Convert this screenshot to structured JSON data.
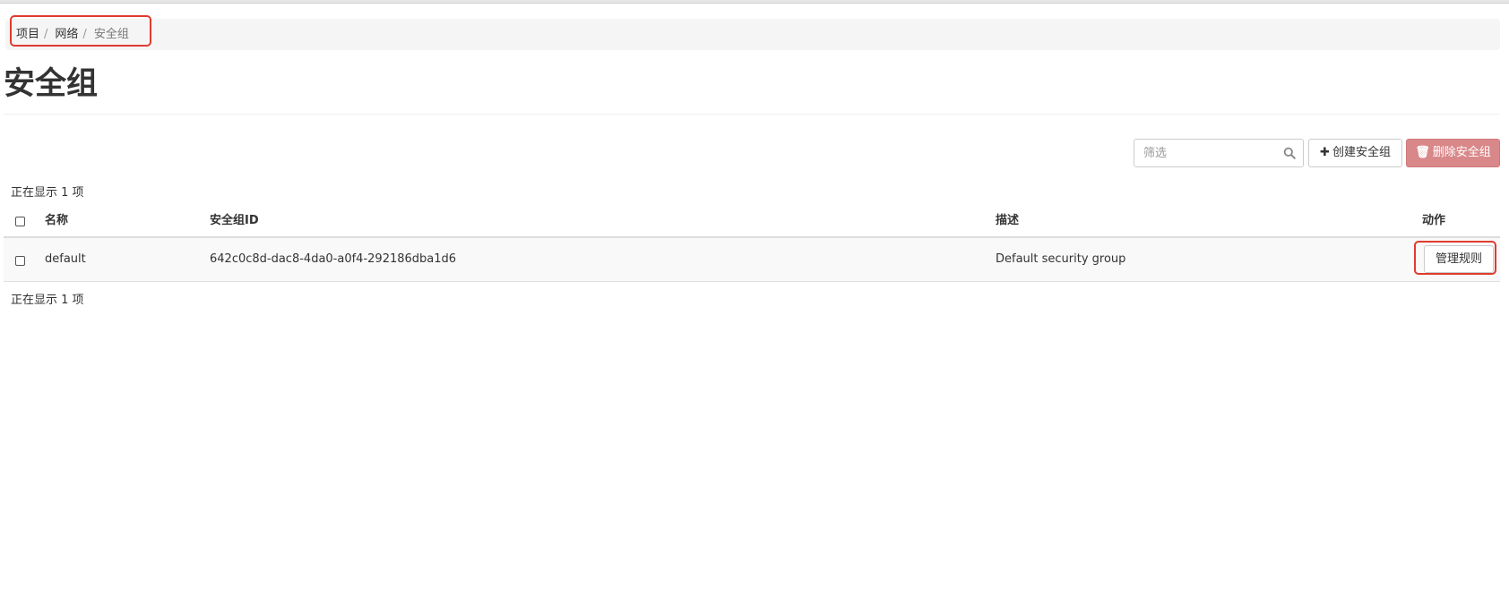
{
  "breadcrumb": {
    "items": [
      {
        "label": "项目"
      },
      {
        "label": "网络"
      },
      {
        "label": "安全组"
      }
    ],
    "separator": "/"
  },
  "page": {
    "title": "安全组"
  },
  "toolbar": {
    "filter_placeholder": "筛选",
    "create_glyph": "✚",
    "create_label": "创建安全组",
    "delete_glyph": "🗑",
    "delete_label": "删除安全组"
  },
  "table": {
    "count_text_top": "正在显示 1 项",
    "count_text_bottom": "正在显示 1 项",
    "columns": {
      "name": "名称",
      "id": "安全组ID",
      "description": "描述",
      "actions": "动作"
    },
    "rows": [
      {
        "name": "default",
        "id": "642c0c8d-dac8-4da0-a0f4-292186dba1d6",
        "description": "Default security group",
        "action_label": "管理规则"
      }
    ]
  },
  "colors": {
    "annotation": "#e03a2f",
    "delete_button": "#d9888a",
    "breadcrumb_bg": "#f5f5f5"
  },
  "icons": {
    "search": "search-icon",
    "create": "plus-icon",
    "delete": "trash-icon"
  }
}
